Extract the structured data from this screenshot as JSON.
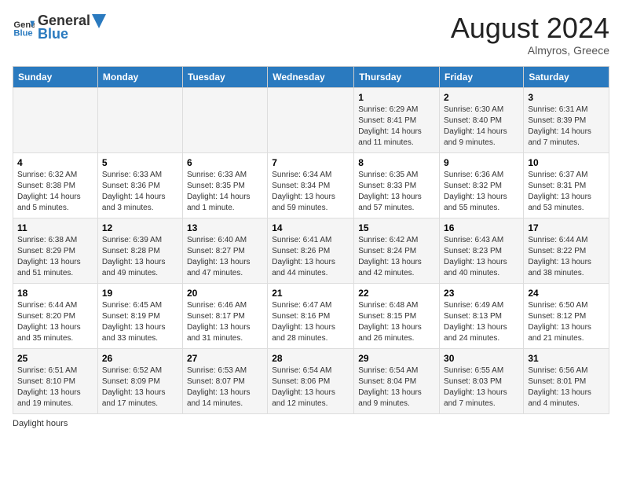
{
  "header": {
    "logo_general": "General",
    "logo_blue": "Blue",
    "month_year": "August 2024",
    "location": "Almyros, Greece"
  },
  "days_of_week": [
    "Sunday",
    "Monday",
    "Tuesday",
    "Wednesday",
    "Thursday",
    "Friday",
    "Saturday"
  ],
  "weeks": [
    [
      {
        "num": "",
        "info": ""
      },
      {
        "num": "",
        "info": ""
      },
      {
        "num": "",
        "info": ""
      },
      {
        "num": "",
        "info": ""
      },
      {
        "num": "1",
        "info": "Sunrise: 6:29 AM\nSunset: 8:41 PM\nDaylight: 14 hours and 11 minutes."
      },
      {
        "num": "2",
        "info": "Sunrise: 6:30 AM\nSunset: 8:40 PM\nDaylight: 14 hours and 9 minutes."
      },
      {
        "num": "3",
        "info": "Sunrise: 6:31 AM\nSunset: 8:39 PM\nDaylight: 14 hours and 7 minutes."
      }
    ],
    [
      {
        "num": "4",
        "info": "Sunrise: 6:32 AM\nSunset: 8:38 PM\nDaylight: 14 hours and 5 minutes."
      },
      {
        "num": "5",
        "info": "Sunrise: 6:33 AM\nSunset: 8:36 PM\nDaylight: 14 hours and 3 minutes."
      },
      {
        "num": "6",
        "info": "Sunrise: 6:33 AM\nSunset: 8:35 PM\nDaylight: 14 hours and 1 minute."
      },
      {
        "num": "7",
        "info": "Sunrise: 6:34 AM\nSunset: 8:34 PM\nDaylight: 13 hours and 59 minutes."
      },
      {
        "num": "8",
        "info": "Sunrise: 6:35 AM\nSunset: 8:33 PM\nDaylight: 13 hours and 57 minutes."
      },
      {
        "num": "9",
        "info": "Sunrise: 6:36 AM\nSunset: 8:32 PM\nDaylight: 13 hours and 55 minutes."
      },
      {
        "num": "10",
        "info": "Sunrise: 6:37 AM\nSunset: 8:31 PM\nDaylight: 13 hours and 53 minutes."
      }
    ],
    [
      {
        "num": "11",
        "info": "Sunrise: 6:38 AM\nSunset: 8:29 PM\nDaylight: 13 hours and 51 minutes."
      },
      {
        "num": "12",
        "info": "Sunrise: 6:39 AM\nSunset: 8:28 PM\nDaylight: 13 hours and 49 minutes."
      },
      {
        "num": "13",
        "info": "Sunrise: 6:40 AM\nSunset: 8:27 PM\nDaylight: 13 hours and 47 minutes."
      },
      {
        "num": "14",
        "info": "Sunrise: 6:41 AM\nSunset: 8:26 PM\nDaylight: 13 hours and 44 minutes."
      },
      {
        "num": "15",
        "info": "Sunrise: 6:42 AM\nSunset: 8:24 PM\nDaylight: 13 hours and 42 minutes."
      },
      {
        "num": "16",
        "info": "Sunrise: 6:43 AM\nSunset: 8:23 PM\nDaylight: 13 hours and 40 minutes."
      },
      {
        "num": "17",
        "info": "Sunrise: 6:44 AM\nSunset: 8:22 PM\nDaylight: 13 hours and 38 minutes."
      }
    ],
    [
      {
        "num": "18",
        "info": "Sunrise: 6:44 AM\nSunset: 8:20 PM\nDaylight: 13 hours and 35 minutes."
      },
      {
        "num": "19",
        "info": "Sunrise: 6:45 AM\nSunset: 8:19 PM\nDaylight: 13 hours and 33 minutes."
      },
      {
        "num": "20",
        "info": "Sunrise: 6:46 AM\nSunset: 8:17 PM\nDaylight: 13 hours and 31 minutes."
      },
      {
        "num": "21",
        "info": "Sunrise: 6:47 AM\nSunset: 8:16 PM\nDaylight: 13 hours and 28 minutes."
      },
      {
        "num": "22",
        "info": "Sunrise: 6:48 AM\nSunset: 8:15 PM\nDaylight: 13 hours and 26 minutes."
      },
      {
        "num": "23",
        "info": "Sunrise: 6:49 AM\nSunset: 8:13 PM\nDaylight: 13 hours and 24 minutes."
      },
      {
        "num": "24",
        "info": "Sunrise: 6:50 AM\nSunset: 8:12 PM\nDaylight: 13 hours and 21 minutes."
      }
    ],
    [
      {
        "num": "25",
        "info": "Sunrise: 6:51 AM\nSunset: 8:10 PM\nDaylight: 13 hours and 19 minutes."
      },
      {
        "num": "26",
        "info": "Sunrise: 6:52 AM\nSunset: 8:09 PM\nDaylight: 13 hours and 17 minutes."
      },
      {
        "num": "27",
        "info": "Sunrise: 6:53 AM\nSunset: 8:07 PM\nDaylight: 13 hours and 14 minutes."
      },
      {
        "num": "28",
        "info": "Sunrise: 6:54 AM\nSunset: 8:06 PM\nDaylight: 13 hours and 12 minutes."
      },
      {
        "num": "29",
        "info": "Sunrise: 6:54 AM\nSunset: 8:04 PM\nDaylight: 13 hours and 9 minutes."
      },
      {
        "num": "30",
        "info": "Sunrise: 6:55 AM\nSunset: 8:03 PM\nDaylight: 13 hours and 7 minutes."
      },
      {
        "num": "31",
        "info": "Sunrise: 6:56 AM\nSunset: 8:01 PM\nDaylight: 13 hours and 4 minutes."
      }
    ]
  ],
  "footer": {
    "daylight_label": "Daylight hours"
  }
}
